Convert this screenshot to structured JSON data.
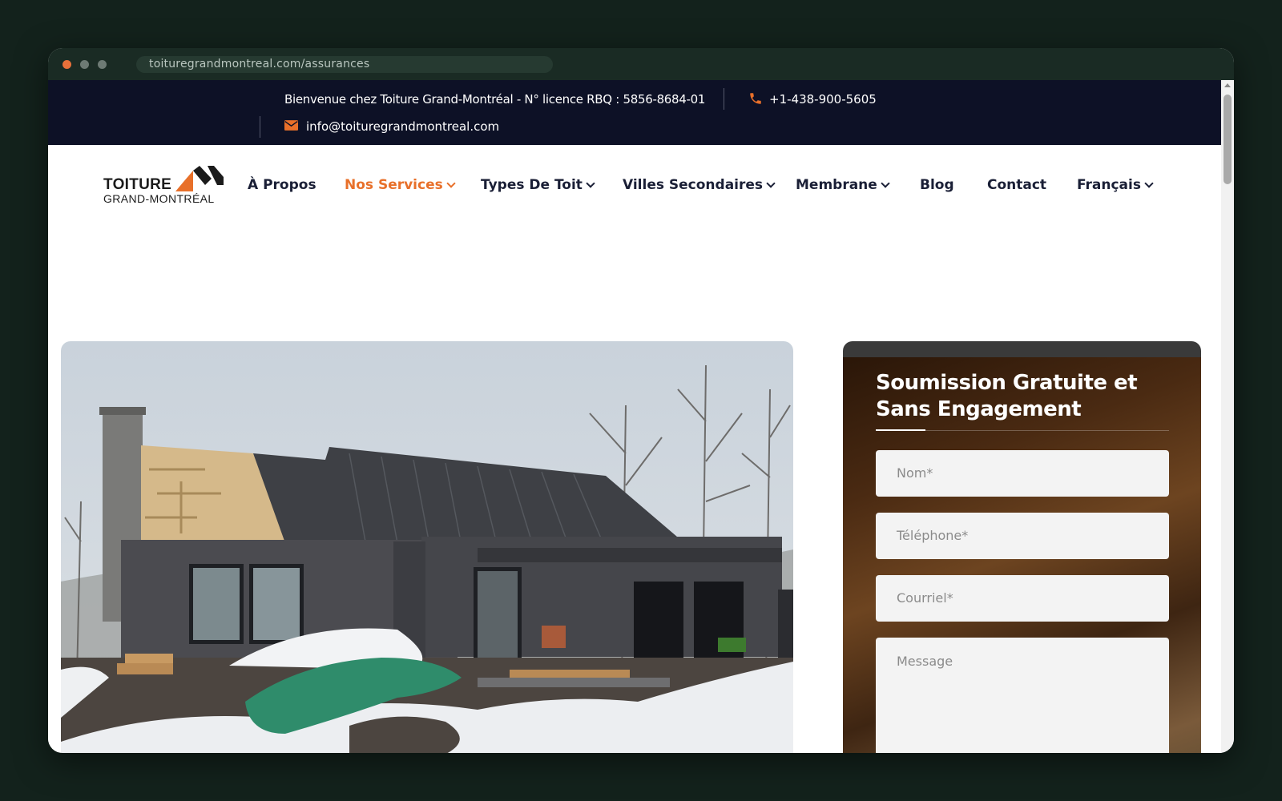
{
  "browser": {
    "url": "toituregrandmontreal.com/assurances"
  },
  "topbar": {
    "welcome": "Bienvenue chez Toiture Grand-Montréal - N° licence RBQ : 5856-8684-01",
    "phone": "+1-438-900-5605",
    "email": "info@toituregrandmontreal.com",
    "accent_color": "#e8702a",
    "background": "#0d1126"
  },
  "logo": {
    "line1": "TOITURE",
    "line2": "GRAND-MONTRÉAL"
  },
  "nav": {
    "items": [
      {
        "label": "À Propos",
        "dropdown": false
      },
      {
        "label": "Nos Services",
        "dropdown": true,
        "active": true
      },
      {
        "label": "Types De Toit",
        "dropdown": true
      },
      {
        "label": "Villes Secondaires",
        "dropdown": true
      },
      {
        "label": "Membrane",
        "dropdown": true
      },
      {
        "label": "Blog",
        "dropdown": false
      },
      {
        "label": "Contact",
        "dropdown": false
      },
      {
        "label": "Français",
        "dropdown": true
      }
    ]
  },
  "form": {
    "title": "Soumission Gratuite et Sans Engagement",
    "name_placeholder": "Nom*",
    "phone_placeholder": "Téléphone*",
    "email_placeholder": "Courriel*",
    "message_placeholder": "Message"
  }
}
